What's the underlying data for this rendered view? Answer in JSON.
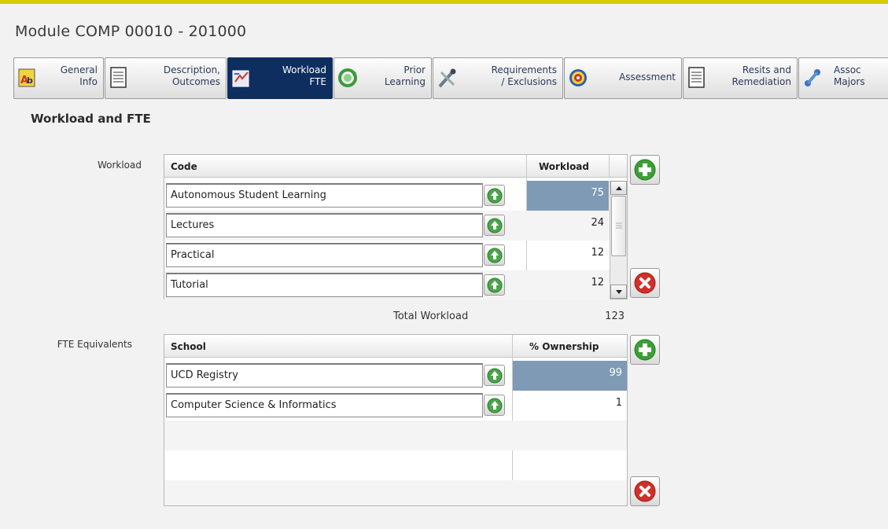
{
  "window": {
    "title": "Module COMP 00010 - 201000"
  },
  "tabs": [
    {
      "line1": "General",
      "line2": "Info",
      "icon": "general-info-icon"
    },
    {
      "line1": "Description,",
      "line2": "Outcomes",
      "icon": "document-icon"
    },
    {
      "line1": "Workload",
      "line2": "FTE",
      "icon": "workload-icon"
    },
    {
      "line1": "Prior",
      "line2": "Learning",
      "icon": "recycle-icon"
    },
    {
      "line1": "Requirements",
      "line2": "/ Exclusions",
      "icon": "tools-icon"
    },
    {
      "line1": "Assessment",
      "line2": "",
      "icon": "target-icon"
    },
    {
      "line1": "Resits and",
      "line2": "Remediation",
      "icon": "document-icon"
    },
    {
      "line1": "Assoc",
      "line2": "Majors",
      "icon": "network-icon"
    }
  ],
  "active_tab": "Workload FTE",
  "section": {
    "title": "Workload and FTE"
  },
  "workload": {
    "label": "Workload",
    "columns": [
      "Code",
      "Workload"
    ],
    "rows": [
      {
        "code": "Autonomous Student Learning",
        "value": "75"
      },
      {
        "code": "Lectures",
        "value": "24"
      },
      {
        "code": "Practical",
        "value": "12"
      },
      {
        "code": "Tutorial",
        "value": "12"
      }
    ],
    "selected_row": 0,
    "total_label": "Total Workload",
    "total_value": "123"
  },
  "fte": {
    "label": "FTE Equivalents",
    "columns": [
      "School",
      "% Ownership"
    ],
    "rows": [
      {
        "school": "UCD Registry",
        "value": "99"
      },
      {
        "school": "Computer Science & Informatics",
        "value": "1"
      }
    ],
    "selected_row": 0
  },
  "colors": {
    "accent_bar": "#d6cc00",
    "active_tab": "#0e2e60",
    "selected_cell": "#7f9ab4",
    "add_green": "#3aa035",
    "remove_red": "#d0302a"
  }
}
